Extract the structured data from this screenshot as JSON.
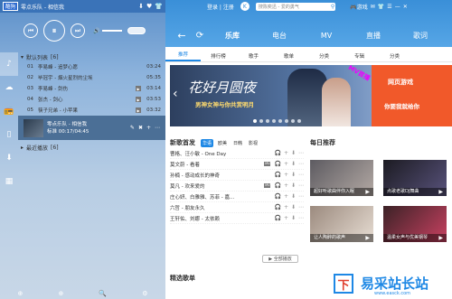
{
  "top_left": {
    "logo": "酷狗",
    "now_title": "零点乐队 - 相信我",
    "icons": [
      "download-icon",
      "heart-icon",
      "skin-icon"
    ]
  },
  "controls": {
    "prev": "⏮",
    "play": "⏸",
    "next": "⏭",
    "volume": "🔊"
  },
  "sidebar": [
    "music-note-icon",
    "cloud-icon",
    "radio-icon",
    "phone-icon",
    "download-icon",
    "grid-icon"
  ],
  "playlist": {
    "header": "默认列表",
    "count": "[6]",
    "tracks": [
      {
        "n": "01",
        "title": "李易峰 - 追梦心愿",
        "dur": "03:24"
      },
      {
        "n": "02",
        "title": "毕冠宇 - 烟火星烈的尘埃",
        "dur": "05:35"
      },
      {
        "n": "03",
        "title": "李易峰 - 剑伤",
        "dur": "03:14"
      },
      {
        "n": "04",
        "title": "张杰 - 剑心",
        "dur": "03:53"
      },
      {
        "n": "05",
        "title": "筷子兄弟 - 小苹果",
        "dur": "03:32"
      }
    ],
    "now": {
      "title": "零点乐队 - 相信我",
      "time": "00:17/04:45",
      "hd": "标准"
    },
    "recent": "最近播放",
    "recent_count": "[6]"
  },
  "right_top": {
    "login": "登录",
    "reg": "注册",
    "k": "K",
    "search_placeholder": "搜陈奕迅 - 爱的勇气",
    "game": "游戏"
  },
  "tabs": [
    "乐库",
    "电台",
    "MV",
    "直播",
    "歌词"
  ],
  "subtabs": [
    "推荐",
    "排行榜",
    "歌手",
    "歌单",
    "分类",
    "专辑",
    "分类"
  ],
  "banner": {
    "big": "花好月圆夜",
    "small": "男神女神与你共赏明月",
    "mv": "MV首播"
  },
  "ad": {
    "t1": "网页游戏",
    "t2": "你要我就给你"
  },
  "newsongs": {
    "title": "新歌首发",
    "filters": [
      "华语",
      "欧美",
      "日韩",
      "影视"
    ],
    "songs": [
      {
        "t": "曹格、汪小敏 - One Day",
        "mv": false
      },
      {
        "t": "莫文蔚 - 看着",
        "mv": true
      },
      {
        "t": "孙楠 - 感动成长的神奇",
        "mv": false
      },
      {
        "t": "莫凡 - 欢来爱的",
        "mv": true
      },
      {
        "t": "庄心妍、白雅雅、苏菲 - 嘉...",
        "mv": false
      },
      {
        "t": "六哲 - 朋友永久",
        "mv": false
      },
      {
        "t": "王轩佑、刘娜 - 太依赖",
        "mv": false
      }
    ],
    "playall": "全部播放"
  },
  "daily": {
    "title": "每日推荐",
    "cards": [
      {
        "lbl": "超好听歌曲伴你入眠"
      },
      {
        "lbl": "点歌老歌DJ舞曲"
      },
      {
        "lbl": "让人陶醉的歌声"
      },
      {
        "lbl": "温柔女声与优美钢琴"
      }
    ]
  },
  "picks": "精选歌单",
  "watermark": {
    "logo": "下",
    "text": "易采站长站",
    "url": "www.easck.com"
  }
}
